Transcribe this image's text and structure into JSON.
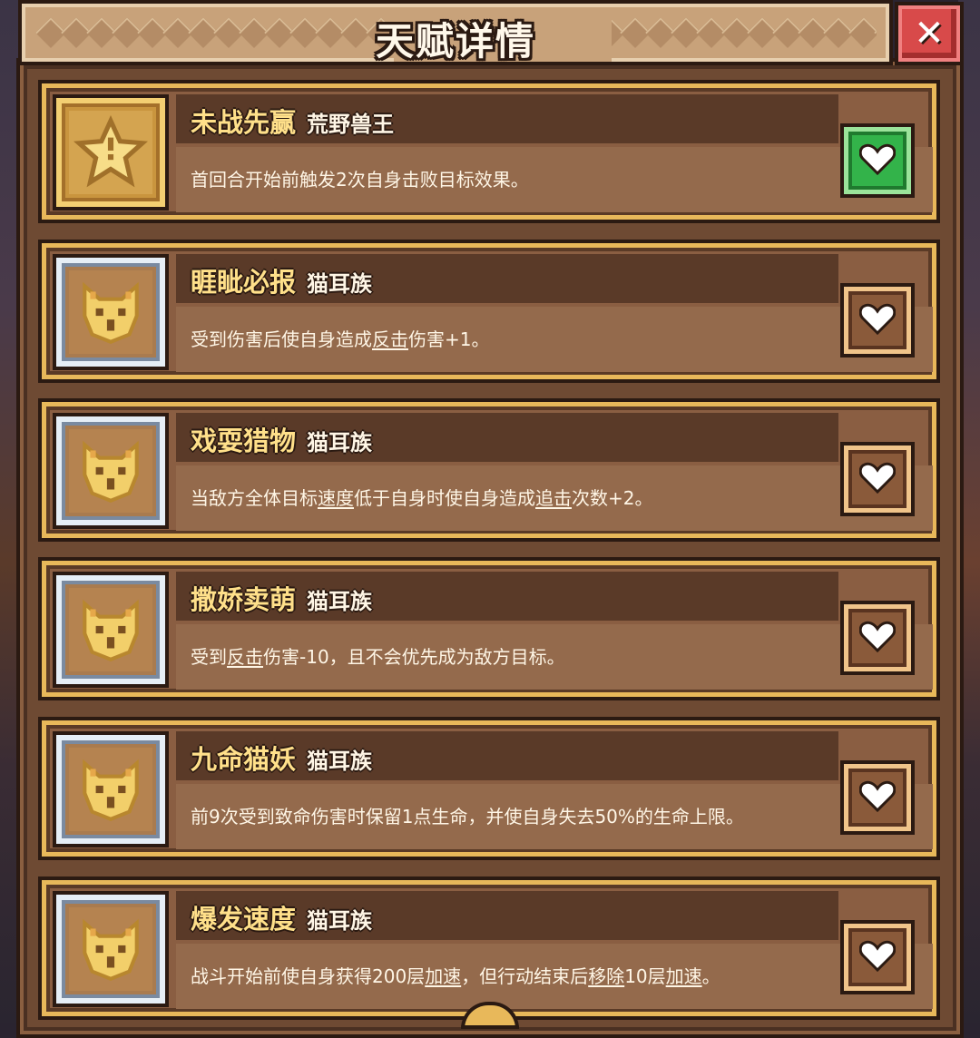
{
  "header": {
    "title": "天赋详情",
    "close_icon": "close-icon"
  },
  "talents": [
    {
      "name": "未战先赢",
      "tag": "荒野兽王",
      "icon": "star-icon",
      "frame": "gold",
      "favorited": true,
      "desc": [
        {
          "t": "首回合开始前触发2次自身击败目标效果。"
        }
      ]
    },
    {
      "name": "睚眦必报",
      "tag": "猫耳族",
      "icon": "cat-face-icon",
      "frame": "silver",
      "favorited": false,
      "desc": [
        {
          "t": "受到伤害后使自身造成"
        },
        {
          "t": "反击",
          "u": true
        },
        {
          "t": "伤害+1。"
        }
      ]
    },
    {
      "name": "戏耍猎物",
      "tag": "猫耳族",
      "icon": "cat-face-icon",
      "frame": "silver",
      "favorited": false,
      "desc": [
        {
          "t": "当敌方全体目标"
        },
        {
          "t": "速度",
          "u": true
        },
        {
          "t": "低于自身时使自身造成"
        },
        {
          "t": "追击",
          "u": true
        },
        {
          "t": "次数+2。"
        }
      ]
    },
    {
      "name": "撒娇卖萌",
      "tag": "猫耳族",
      "icon": "cat-face-icon",
      "frame": "silver",
      "favorited": false,
      "desc": [
        {
          "t": "受到"
        },
        {
          "t": "反击",
          "u": true
        },
        {
          "t": "伤害-10，且不会优先成为敌方目标。"
        }
      ]
    },
    {
      "name": "九命猫妖",
      "tag": "猫耳族",
      "icon": "cat-face-icon",
      "frame": "silver",
      "favorited": false,
      "desc": [
        {
          "t": "前9次受到致命伤害时保留1点生命，并使自身失去50%的生命上限。"
        }
      ]
    },
    {
      "name": "爆发速度",
      "tag": "猫耳族",
      "icon": "cat-face-icon",
      "frame": "silver",
      "favorited": false,
      "desc": [
        {
          "t": "战斗开始前使自身获得200层"
        },
        {
          "t": "加速",
          "u": true
        },
        {
          "t": "，但行动结束后"
        },
        {
          "t": "移除",
          "u": true
        },
        {
          "t": "10层"
        },
        {
          "t": "加速",
          "u": true
        },
        {
          "t": "。"
        }
      ]
    }
  ],
  "colors": {
    "title": "#ffe08a",
    "favorite_on": "#33b34a",
    "favorite_off": "#8a5a3a"
  }
}
